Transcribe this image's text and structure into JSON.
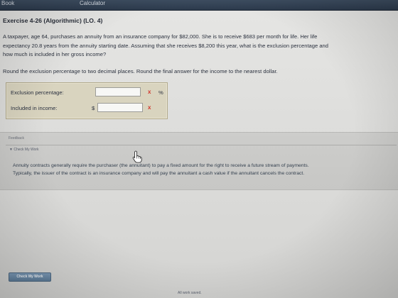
{
  "topbar": {
    "tabs": [
      "Book",
      "Calculator"
    ]
  },
  "exercise": {
    "title": "Exercise 4-26 (Algorithmic) (LO. 4)",
    "problem_lines": [
      "A taxpayer, age 64, purchases an annuity from an insurance company for $82,000. She is to receive $683 per month for life. Her life",
      "expectancy 20.8 years from the annuity starting date. Assuming that she receives $8,200 this year, what is the exclusion percentage and",
      "how much is included in her gross income?"
    ],
    "instruction": "Round the exclusion percentage to two decimal places. Round the final answer for the income to the nearest dollar."
  },
  "answers": {
    "exclusion_label": "Exclusion percentage:",
    "exclusion_value": "",
    "exclusion_unit": "%",
    "income_label": "Included in income:",
    "income_prefix": "$",
    "income_value": "",
    "wrong_mark": "x"
  },
  "feedback": {
    "title": "Feedback",
    "check_toggle": "▼ Check My Work",
    "lines": [
      "Annuity contracts generally require the purchaser (the annuitant) to pay a fixed amount for the right to receive a future stream of payments.",
      "Typically, the issuer of the contract is an insurance company and will pay the annuitant a cash value if the annuitant cancels the contract."
    ]
  },
  "footer": {
    "check_button": "Check My Work",
    "status": "All work saved."
  },
  "colors": {
    "topbar": "#2c3a4c",
    "answer_box": "#d9d4bf",
    "wrong_mark": "#d2372d",
    "button": "#5d7c99"
  },
  "icons": [
    "pointer-hand-icon",
    "wrong-x-icon"
  ]
}
